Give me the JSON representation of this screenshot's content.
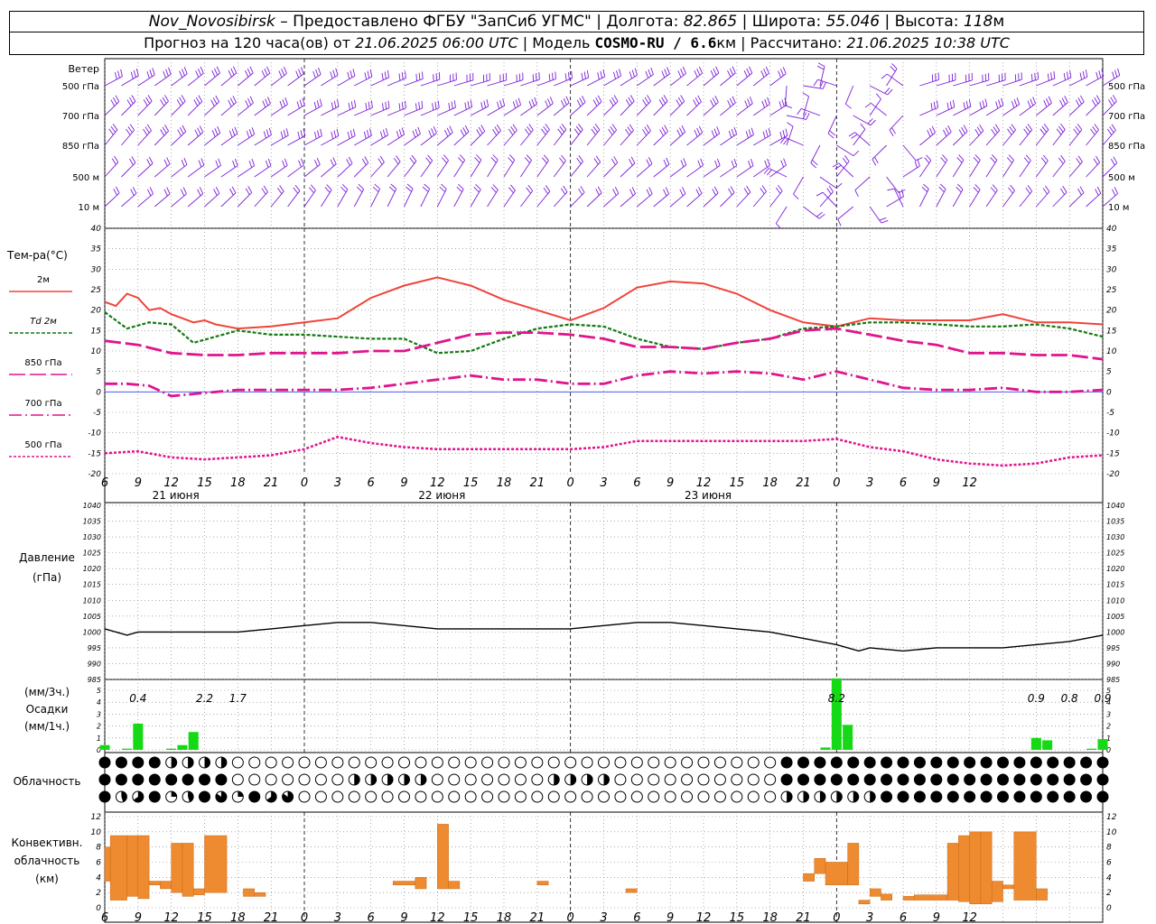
{
  "header": {
    "station": "Nov_Novosibirsk",
    "provider": " – Предоставлено ФГБУ \"ЗапСиб УГМС\" | Долгота: ",
    "lon": "82.865",
    "lat_label": " | Широта: ",
    "lat": "55.046",
    "alt_label": " | Высота: ",
    "alt": "118",
    "alt_unit": "м",
    "forecast_label": "Прогноз на 120 часа(ов) от ",
    "forecast_start": "21.06.2025 06:00 UTC",
    "model_label": "  | Модель ",
    "model": "COSMO-RU / 6.6",
    "model_unit": "км",
    "calc_label": " | Рассчитано: ",
    "calc_time": "21.06.2025 10:38 UTC"
  },
  "wind": {
    "title": "Ветер",
    "levels": [
      "500 гПа",
      "700 гПа",
      "850 гПа",
      "500 м",
      "10  м"
    ],
    "color": "#7b1fd8"
  },
  "temperature": {
    "title": "Тем-ра(°С)",
    "legend": [
      {
        "label": "2м",
        "color": "#f0433a"
      },
      {
        "label": "Td  2м",
        "color": "#127a12"
      },
      {
        "label": "850 гПа",
        "color": "#e0148c"
      },
      {
        "label": "700 гПа",
        "color": "#e0148c"
      },
      {
        "label": "500 гПа",
        "color": "#e0148c"
      }
    ]
  },
  "pressure": {
    "title": "Давление",
    "unit": "(гПа)"
  },
  "precip": {
    "unit1": "(мм/3ч.)",
    "title": "Осадки",
    "unit2": "(мм/1ч.)",
    "labels": [
      {
        "hour": 3,
        "text": "0.4"
      },
      {
        "hour": 9,
        "text": "2.2"
      },
      {
        "hour": 12,
        "text": "1.7"
      },
      {
        "hour": 66,
        "text": "8.2"
      },
      {
        "hour": 84,
        "text": "0.9"
      },
      {
        "hour": 87,
        "text": "0.8"
      },
      {
        "hour": 90,
        "text": "0.9"
      }
    ]
  },
  "cloud": {
    "title": "Облачность"
  },
  "convective": {
    "title1": "Конвективн.",
    "title2": "облачность",
    "unit": "(км)"
  },
  "days": [
    "21 июня",
    "22 июня",
    "23 июня"
  ],
  "hour_ticks": [
    "6",
    "9",
    "12",
    "15",
    "18",
    "21",
    "0",
    "3",
    "6",
    "9",
    "12",
    "15",
    "18",
    "21",
    "0",
    "3",
    "6",
    "9",
    "12",
    "15",
    "18",
    "21",
    "0",
    "3",
    "6",
    "9",
    "12"
  ],
  "chart_data": [
    {
      "type": "line",
      "title": "Тем-ра(°С)",
      "x_unit": "hours since 21.06.2025 06:00 UTC",
      "ylim": [
        -20,
        40
      ],
      "yticks": [
        -20,
        -15,
        -10,
        -5,
        0,
        5,
        10,
        15,
        20,
        25,
        30,
        35,
        40
      ],
      "series": [
        {
          "name": "2м",
          "color": "#f0433a",
          "x": [
            0,
            1,
            2,
            3,
            4,
            5,
            6,
            7,
            8,
            9,
            10,
            11,
            12,
            15,
            18,
            21,
            24,
            27,
            30,
            33,
            36,
            39,
            42,
            45,
            48,
            51,
            54,
            57,
            60,
            63,
            66,
            69,
            72,
            75,
            78,
            81,
            84,
            87,
            90
          ],
          "y": [
            22,
            21,
            24,
            23,
            20,
            20.5,
            19,
            18,
            17,
            17.5,
            16.5,
            16,
            15.5,
            16,
            17,
            18,
            23,
            26,
            28,
            26,
            22.5,
            20,
            17.5,
            20.5,
            25.5,
            27,
            26.5,
            24,
            20,
            17,
            16,
            18,
            17.5,
            17.5,
            17.5,
            19,
            17,
            17,
            16.5
          ]
        },
        {
          "name": "Td  2м",
          "color": "#127a12",
          "x": [
            0,
            2,
            4,
            6,
            8,
            12,
            15,
            18,
            21,
            24,
            27,
            30,
            33,
            36,
            39,
            42,
            45,
            48,
            51,
            54,
            57,
            60,
            63,
            66,
            69,
            72,
            75,
            78,
            81,
            84,
            87,
            90
          ],
          "y": [
            19.5,
            15.5,
            17,
            16.5,
            12,
            15,
            14,
            14,
            13.5,
            13,
            13,
            9.5,
            10,
            13,
            15.5,
            16.5,
            16,
            13,
            11,
            10.5,
            12,
            13,
            15.5,
            16,
            17,
            17,
            16.5,
            16,
            16,
            16.5,
            15.5,
            13.5
          ]
        },
        {
          "name": "850 гПа",
          "color": "#e0148c",
          "x": [
            0,
            3,
            6,
            9,
            12,
            15,
            18,
            21,
            24,
            27,
            30,
            33,
            36,
            39,
            42,
            45,
            48,
            51,
            54,
            57,
            60,
            63,
            66,
            69,
            72,
            75,
            78,
            81,
            84,
            87,
            90
          ],
          "y": [
            12.5,
            11.5,
            9.5,
            9,
            9,
            9.5,
            9.5,
            9.5,
            10,
            10,
            12,
            14,
            14.5,
            14.5,
            14,
            13,
            11,
            11,
            10.5,
            12,
            13,
            15,
            15.5,
            14,
            12.5,
            11.5,
            9.5,
            9.5,
            9,
            9,
            8
          ]
        },
        {
          "name": "700 гПа",
          "color": "#e0148c",
          "x": [
            0,
            2,
            4,
            6,
            8,
            12,
            15,
            18,
            21,
            24,
            27,
            30,
            33,
            36,
            39,
            42,
            45,
            48,
            51,
            54,
            57,
            60,
            63,
            66,
            69,
            72,
            75,
            78,
            81,
            84,
            87,
            90
          ],
          "y": [
            2,
            2,
            1.5,
            -1,
            -0.5,
            0.5,
            0.5,
            0.5,
            0.5,
            1,
            2,
            3,
            4,
            3,
            3,
            2,
            2,
            4,
            5,
            4.5,
            5,
            4.5,
            3,
            5,
            3,
            1,
            0.5,
            0.5,
            1,
            0,
            0,
            0.5
          ]
        },
        {
          "name": "500 гПа",
          "color": "#e0148c",
          "x": [
            0,
            3,
            6,
            9,
            12,
            15,
            18,
            21,
            24,
            27,
            30,
            33,
            36,
            39,
            42,
            45,
            48,
            51,
            54,
            57,
            60,
            63,
            66,
            69,
            72,
            75,
            78,
            81,
            84,
            87,
            90
          ],
          "y": [
            -15,
            -14.5,
            -16,
            -16.5,
            -16,
            -15.5,
            -14,
            -11,
            -12.5,
            -13.5,
            -14,
            -14,
            -14,
            -14,
            -14,
            -13.5,
            -12,
            -12,
            -12,
            -12,
            -12,
            -12,
            -11.5,
            -13.5,
            -14.5,
            -16.5,
            -17.5,
            -18,
            -17.5,
            -16,
            -15.5
          ]
        }
      ]
    },
    {
      "type": "line",
      "title": "Давление",
      "ylabel": "(гПа)",
      "ylim": [
        985,
        1040
      ],
      "yticks": [
        985,
        990,
        995,
        1000,
        1005,
        1010,
        1015,
        1020,
        1025,
        1030,
        1035,
        1040
      ],
      "series": [
        {
          "name": "",
          "color": "#000000",
          "x": [
            0,
            2,
            3,
            6,
            9,
            12,
            15,
            18,
            21,
            24,
            27,
            30,
            33,
            36,
            39,
            42,
            45,
            48,
            51,
            54,
            57,
            60,
            63,
            66,
            68,
            69,
            72,
            75,
            78,
            81,
            84,
            87,
            90
          ],
          "y": [
            1001,
            999,
            1000,
            1000,
            1000,
            1000,
            1001,
            1002,
            1003,
            1003,
            1002,
            1001,
            1001,
            1001,
            1001,
            1001,
            1002,
            1003,
            1003,
            1002,
            1001,
            1000,
            998,
            996,
            994,
            995,
            994,
            995,
            995,
            995,
            996,
            997,
            999
          ]
        }
      ]
    },
    {
      "type": "bar",
      "title": "Осадки",
      "ylabel": "(мм/1ч.)",
      "ylim": [
        0,
        5
      ],
      "yticks": [
        0,
        1,
        2,
        3,
        4,
        5
      ],
      "x": [
        0,
        2,
        3,
        6,
        7,
        8,
        65,
        66,
        67,
        84,
        85,
        89,
        90
      ],
      "values": [
        0.4,
        0.1,
        2.2,
        0.1,
        0.4,
        1.5,
        0.2,
        6,
        2.1,
        1,
        0.8,
        0.1,
        0.9
      ],
      "color": "#16d916"
    },
    {
      "type": "bar",
      "title": "Конвективн. облачность",
      "ylabel": "(км)",
      "ylim": [
        0,
        12
      ],
      "yticks": [
        0,
        2,
        4,
        6,
        8,
        10,
        12
      ],
      "bars": [
        {
          "x0": 0,
          "x1": 0.5,
          "lo": 3.5,
          "hi": 8
        },
        {
          "x0": 0.5,
          "x1": 2,
          "lo": 1,
          "hi": 9.5
        },
        {
          "x0": 2,
          "x1": 3,
          "lo": 1.5,
          "hi": 9.5
        },
        {
          "x0": 3,
          "x1": 4,
          "lo": 1.2,
          "hi": 9.5
        },
        {
          "x0": 4,
          "x1": 5,
          "lo": 3,
          "hi": 3.5
        },
        {
          "x0": 5,
          "x1": 6,
          "lo": 2.5,
          "hi": 3.5
        },
        {
          "x0": 6,
          "x1": 7,
          "lo": 2,
          "hi": 8.5
        },
        {
          "x0": 7,
          "x1": 8,
          "lo": 1.5,
          "hi": 8.5
        },
        {
          "x0": 8,
          "x1": 9,
          "lo": 1.7,
          "hi": 2.5
        },
        {
          "x0": 9,
          "x1": 11,
          "lo": 2,
          "hi": 9.5
        },
        {
          "x0": 12.5,
          "x1": 13.5,
          "lo": 1.5,
          "hi": 2.5
        },
        {
          "x0": 13.5,
          "x1": 14.5,
          "lo": 1.5,
          "hi": 2
        },
        {
          "x0": 26,
          "x1": 28,
          "lo": 3,
          "hi": 3.5
        },
        {
          "x0": 28,
          "x1": 29,
          "lo": 2.5,
          "hi": 4
        },
        {
          "x0": 30,
          "x1": 31,
          "lo": 2.5,
          "hi": 11
        },
        {
          "x0": 31,
          "x1": 32,
          "lo": 2.5,
          "hi": 3.5
        },
        {
          "x0": 39,
          "x1": 40,
          "lo": 3,
          "hi": 3.5
        },
        {
          "x0": 47,
          "x1": 48,
          "lo": 2,
          "hi": 2.5
        },
        {
          "x0": 63,
          "x1": 64,
          "lo": 3.5,
          "hi": 4.5
        },
        {
          "x0": 64,
          "x1": 65,
          "lo": 4.5,
          "hi": 6.5
        },
        {
          "x0": 65,
          "x1": 67,
          "lo": 3,
          "hi": 6
        },
        {
          "x0": 67,
          "x1": 68,
          "lo": 3,
          "hi": 8.5
        },
        {
          "x0": 68,
          "x1": 69,
          "lo": 0.5,
          "hi": 1
        },
        {
          "x0": 69,
          "x1": 70,
          "lo": 1.5,
          "hi": 2.5
        },
        {
          "x0": 70,
          "x1": 71,
          "lo": 1,
          "hi": 1.8
        },
        {
          "x0": 72,
          "x1": 73,
          "lo": 1,
          "hi": 1.5
        },
        {
          "x0": 73,
          "x1": 76,
          "lo": 1,
          "hi": 1.7
        },
        {
          "x0": 76,
          "x1": 77,
          "lo": 1,
          "hi": 8.5
        },
        {
          "x0": 77,
          "x1": 78,
          "lo": 0.8,
          "hi": 9.5
        },
        {
          "x0": 78,
          "x1": 79,
          "lo": 0.5,
          "hi": 10
        },
        {
          "x0": 79,
          "x1": 80,
          "lo": 0.5,
          "hi": 10
        },
        {
          "x0": 80,
          "x1": 81,
          "lo": 0.8,
          "hi": 3.5
        },
        {
          "x0": 81,
          "x1": 82,
          "lo": 2.5,
          "hi": 3
        },
        {
          "x0": 82,
          "x1": 84,
          "lo": 1,
          "hi": 10
        },
        {
          "x0": 84,
          "x1": 85,
          "lo": 1,
          "hi": 2.5
        }
      ],
      "color": "#ee8a30"
    }
  ]
}
